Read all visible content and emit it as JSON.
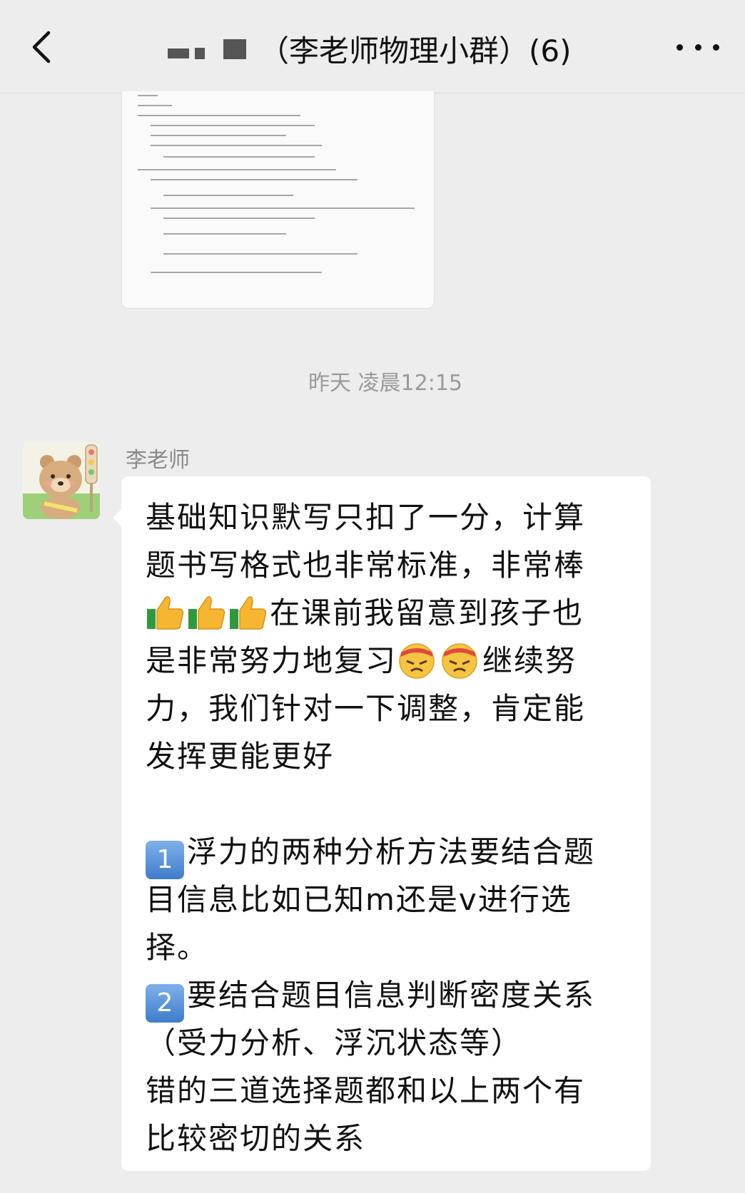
{
  "header": {
    "back_icon": "chevron-left-icon",
    "title": "（李老师物理小群）(6)",
    "more_icon": "ellipsis-icon"
  },
  "image_message": {
    "type": "document-photo"
  },
  "timestamp": "昨天 凌晨12:15",
  "message": {
    "sender": "李老师",
    "avatar_icon": "bear-avatar-icon",
    "lines": [
      "基础知识默写只扣了一分，计算",
      "题书写格式也非常标准，非常棒",
      "在课前我留意到孩子也",
      "是非常努力地复习",
      "继续努",
      "力，我们针对一下调整，肯定能",
      "发挥更能更好",
      "浮力的两种分析方法要结合题",
      "目信息比如已知m还是v进行选",
      "择。",
      "要结合题目信息判断密度关系",
      "（受力分析、浮沉状态等）",
      "错的三道选择题都和以上两个有",
      "比较密切的关系"
    ],
    "badge_1": "1",
    "badge_2": "2"
  },
  "colors": {
    "background": "#ededed",
    "bubble": "#ffffff",
    "timestamp": "#9a9a9a",
    "sender": "#8a8a8a"
  }
}
